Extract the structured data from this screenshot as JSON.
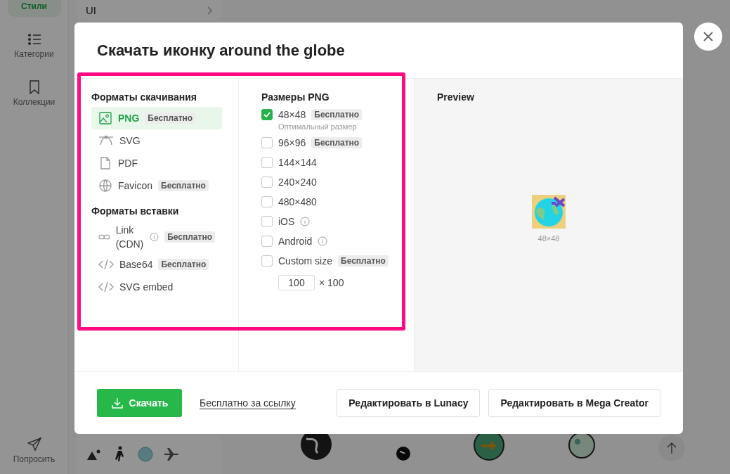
{
  "sidebar": {
    "items": [
      {
        "label": "Стили",
        "selected": true
      },
      {
        "label": "Категории",
        "selected": false
      },
      {
        "label": "Коллекции",
        "selected": false
      },
      {
        "label": "Попросить",
        "selected": false
      }
    ]
  },
  "category_card": {
    "label": "UI"
  },
  "dialog": {
    "title": "Скачать иконку around the globe",
    "download_formats": {
      "heading": "Форматы скачивания",
      "items": [
        {
          "label": "PNG",
          "badge": "Бесплатно",
          "selected": true
        },
        {
          "label": "SVG",
          "selected": false
        },
        {
          "label": "PDF",
          "selected": false
        },
        {
          "label": "Favicon",
          "badge": "Бесплатно",
          "selected": false
        }
      ]
    },
    "embed_formats": {
      "heading": "Форматы вставки",
      "items": [
        {
          "label": "Link (CDN)",
          "info": true,
          "badge": "Бесплатно",
          "selected": false
        },
        {
          "label": "Base64",
          "info": false,
          "badge": "Бесплатно",
          "selected": false
        },
        {
          "label": "SVG embed",
          "info": false,
          "selected": false
        }
      ]
    },
    "png_sizes": {
      "heading": "Размеры PNG",
      "items": [
        {
          "label": "48×48",
          "badge": "Бесплатно",
          "note": "Оптимальный размер",
          "checked": true,
          "info": false
        },
        {
          "label": "96×96",
          "badge": "Бесплатно",
          "checked": false,
          "info": false
        },
        {
          "label": "144×144",
          "checked": false,
          "info": false
        },
        {
          "label": "240×240",
          "checked": false,
          "info": false
        },
        {
          "label": "480×480",
          "checked": false,
          "info": false
        },
        {
          "label": "iOS",
          "checked": false,
          "info": true
        },
        {
          "label": "Android",
          "checked": false,
          "info": true
        },
        {
          "label": "Custom size",
          "badge": "Бесплатно",
          "checked": false,
          "info": false
        }
      ],
      "custom": {
        "value": "100",
        "suffix": "× 100"
      }
    },
    "preview": {
      "heading": "Preview",
      "caption": "48×48"
    },
    "footer": {
      "download": "Скачать",
      "free_link": "Бесплатно за ссылку",
      "buttons": [
        "Редактировать в Lunacy",
        "Редактировать в Mega Creator"
      ]
    }
  }
}
